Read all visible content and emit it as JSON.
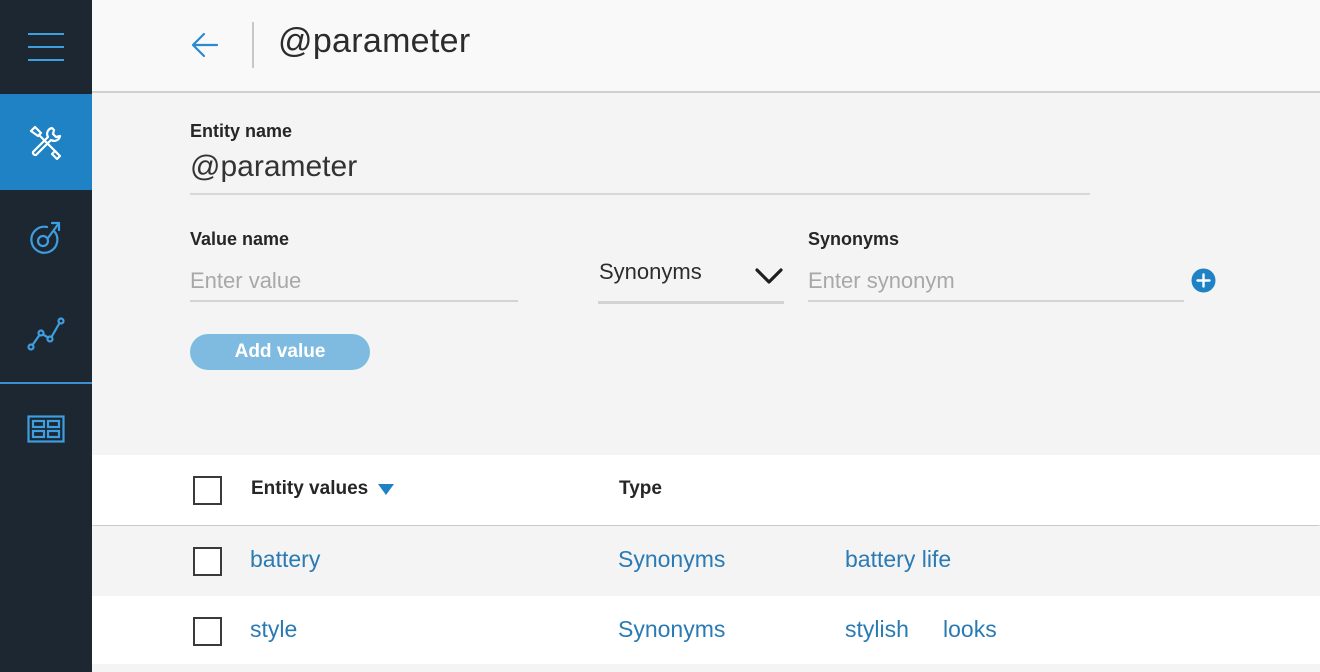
{
  "sidebar": {
    "items": [
      {
        "name": "menu",
        "icon": "hamburger-menu-icon"
      },
      {
        "name": "build",
        "icon": "tools-icon",
        "active": true
      },
      {
        "name": "improve",
        "icon": "target-arrow-icon"
      },
      {
        "name": "analytics",
        "icon": "line-chart-icon"
      },
      {
        "name": "deploy",
        "icon": "dashboard-icon"
      }
    ],
    "active_color": "#1f82c4",
    "background": "#1d2732"
  },
  "header": {
    "title": "@parameter",
    "back_icon": "arrow-left-icon"
  },
  "form": {
    "entity_name_label": "Entity name",
    "entity_name_value": "@parameter",
    "value_name_label": "Value name",
    "value_placeholder": "Enter value",
    "type_selected": "Synonyms",
    "synonyms_label": "Synonyms",
    "synonym_placeholder": "Enter synonym",
    "add_value_label": "Add value"
  },
  "table": {
    "columns": [
      "Entity values",
      "Type"
    ],
    "sort": "descending",
    "rows": [
      {
        "value": "battery",
        "type": "Synonyms",
        "synonyms": [
          "battery life"
        ]
      },
      {
        "value": "style",
        "type": "Synonyms",
        "synonyms": [
          "stylish",
          "looks"
        ]
      }
    ]
  },
  "colors": {
    "link": "#2a7ab4",
    "accent": "#1f82c4",
    "button_disabled": "#7fbbe0"
  }
}
